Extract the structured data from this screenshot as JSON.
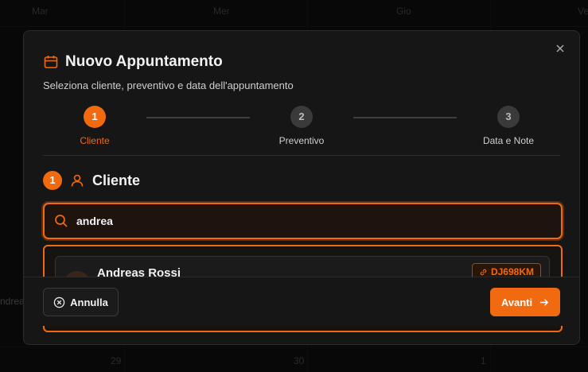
{
  "calendar": {
    "day_headers": [
      "Mar",
      "Mer",
      "Gio",
      "Ve"
    ],
    "event_text": "ndreas",
    "day_numbers": [
      "29",
      "30",
      "1"
    ]
  },
  "modal": {
    "title": "Nuovo Appuntamento",
    "subtitle": "Seleziona cliente, preventivo e data dell'appuntamento",
    "close_icon": "close-icon",
    "steps": [
      {
        "number": "1",
        "label": "Cliente",
        "active": true
      },
      {
        "number": "2",
        "label": "Preventivo",
        "active": false
      },
      {
        "number": "3",
        "label": "Data e Note",
        "active": false
      }
    ],
    "section": {
      "number": "1",
      "title": "Cliente",
      "icon": "user-icon"
    },
    "search": {
      "value": "andrea",
      "icon": "search-icon"
    },
    "results": [
      {
        "name": "Andreas Rossi",
        "plate": "DJ698KM",
        "plate_icon": "link-icon"
      }
    ],
    "footer": {
      "cancel_label": "Annulla",
      "next_label": "Avanti"
    }
  },
  "colors": {
    "accent": "#f26a0f",
    "background": "#161616"
  }
}
